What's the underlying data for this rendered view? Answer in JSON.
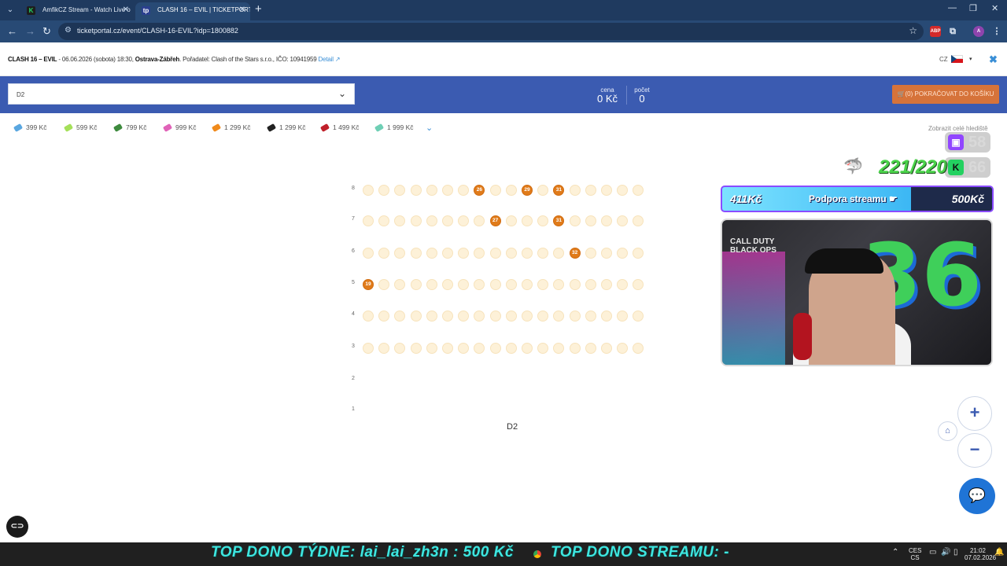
{
  "browser": {
    "tabs": [
      {
        "title": "AmfikCZ Stream - Watch Live o",
        "favicon": "K",
        "active": false
      },
      {
        "title": "CLASH 16 – EVIL | TICKETPORT",
        "favicon": "tp",
        "active": true
      }
    ],
    "url": "ticketportal.cz/event/CLASH-16-EVIL?idp=1800882",
    "extensions": [
      "ABP",
      "A"
    ]
  },
  "event": {
    "name": "CLASH 16 – EVIL",
    "info_rest": " - 06.06.2026 (sobota) 18:30, ",
    "venue": "Ostrava-Zábřeh",
    "organizer": ". Pořadatel: Clash of the Stars s.r.o., IČO: 10941959 ",
    "detail_link": "Detail",
    "language": "CZ"
  },
  "toolbar": {
    "sector_value": "D2",
    "price_label": "cena",
    "price_value": "0 Kč",
    "count_label": "počet",
    "count_value": "0",
    "cart_label": "(0) POKRAČOVAT DO KOŠÍKU"
  },
  "price_legend": [
    {
      "label": "399 Kč",
      "color": "#5aa7e0"
    },
    {
      "label": "599 Kč",
      "color": "#a5e05a"
    },
    {
      "label": "799 Kč",
      "color": "#3e8a3e"
    },
    {
      "label": "999 Kč",
      "color": "#e063b8"
    },
    {
      "label": "1 299 Kč",
      "color": "#f08a1c"
    },
    {
      "label": "1 299 Kč",
      "color": "#222222"
    },
    {
      "label": "1 499 Kč",
      "color": "#c0202a"
    },
    {
      "label": "1 999 Kč",
      "color": "#6fcfb5"
    }
  ],
  "show_all_link": "Zobrazit celé hlediště",
  "seat_map": {
    "sector_name": "D2",
    "rows": [
      {
        "label": "8",
        "seats": 18,
        "available": [
          {
            "index": 7,
            "number": "26"
          },
          {
            "index": 10,
            "number": "29"
          },
          {
            "index": 12,
            "number": "31"
          }
        ]
      },
      {
        "label": "7",
        "seats": 18,
        "available": [
          {
            "index": 8,
            "number": "27"
          },
          {
            "index": 12,
            "number": "31"
          }
        ]
      },
      {
        "label": "6",
        "seats": 18,
        "available": [
          {
            "index": 13,
            "number": "32"
          }
        ]
      },
      {
        "label": "5",
        "seats": 18,
        "available": [
          {
            "index": 0,
            "number": "19"
          }
        ]
      },
      {
        "label": "4",
        "seats": 18,
        "available": []
      },
      {
        "label": "3",
        "seats": 18,
        "available": []
      },
      {
        "label": "2",
        "seats": 0,
        "available": []
      },
      {
        "label": "1",
        "seats": 0,
        "available": []
      }
    ]
  },
  "stream_overlay": {
    "twitch_viewers": "58",
    "kick_viewers": "66",
    "followers": "221/220",
    "donate_left": "411Kč",
    "donate_title": "Podpora streamu",
    "donate_right": "500Kč",
    "donate_progress": 0.82,
    "webcam_text": "CALL DUTY\nBLACK OPS",
    "webcam_number": "36",
    "ticker_week": "TOP DONO TÝDNE:  lai_lai_zh3n : 500 Kč",
    "ticker_stream": "TOP DONO STREAMU: -"
  },
  "taskbar": {
    "lang_top": "CES",
    "lang_bottom": "CS",
    "time": "21:02",
    "date": "07.02.2026"
  }
}
